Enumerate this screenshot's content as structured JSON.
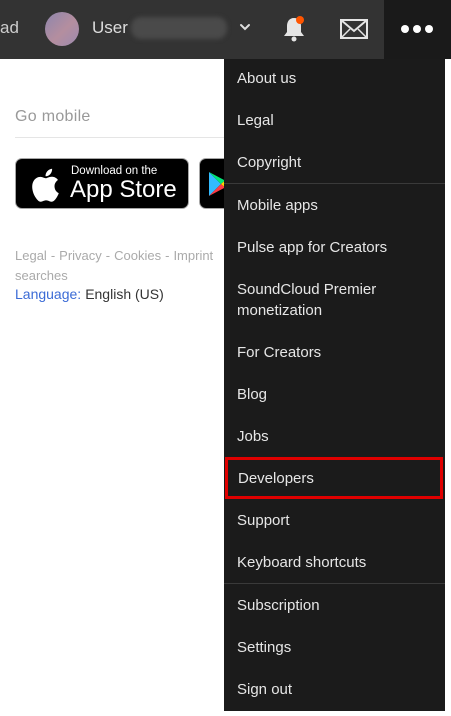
{
  "header": {
    "upload_label": "ad",
    "user_label": "User",
    "icons": [
      "chevron-down-icon",
      "bell-icon",
      "mail-icon",
      "more-icon"
    ],
    "notification_color": "#ff5500",
    "background": "#333333"
  },
  "main": {
    "go_mobile": "Go mobile",
    "app_store": {
      "small_text": "Download on the",
      "big_text": "App Store"
    },
    "footer_links": [
      "Legal",
      "Privacy",
      "Cookies",
      "Imprint"
    ],
    "footer_links_wrap": "searches",
    "language_label": "Language:",
    "language_value": "English (US)",
    "link_color": "#3b6bd6"
  },
  "dropdown": {
    "groups": [
      [
        "About us",
        "Legal",
        "Copyright"
      ],
      [
        "Mobile apps",
        "Pulse app for Creators",
        "SoundCloud Premier monetization",
        "For Creators",
        "Blog",
        "Jobs",
        "Developers",
        "Support",
        "Keyboard shortcuts"
      ],
      [
        "Subscription",
        "Settings",
        "Sign out"
      ]
    ],
    "highlighted_item": "Developers",
    "highlight_color": "#e00000"
  }
}
